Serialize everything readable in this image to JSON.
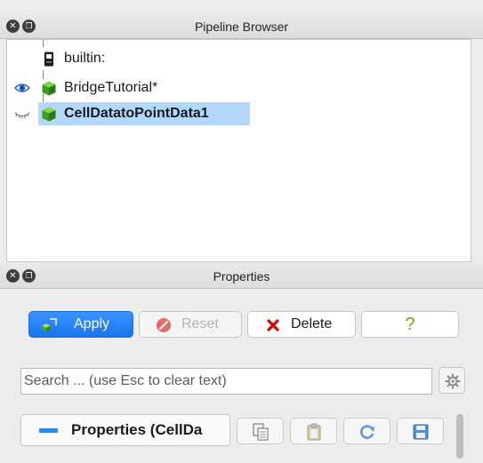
{
  "pipeline_browser": {
    "title": "Pipeline Browser",
    "items": [
      {
        "label": "builtin:"
      },
      {
        "label": "BridgeTutorial*"
      },
      {
        "label": "CellDatatoPointData1"
      }
    ]
  },
  "properties_panel": {
    "title": "Properties",
    "apply_label": "Apply",
    "reset_label": "Reset",
    "delete_label": "Delete",
    "help_label": "?",
    "search_placeholder": "Search ... (use Esc to clear text)",
    "section_label": "Properties (CellDa"
  },
  "colors": {
    "accent": "#1a74ee",
    "selection": "#b3d7ff",
    "cube_green": "#4caf22",
    "delete_red": "#d40000"
  }
}
